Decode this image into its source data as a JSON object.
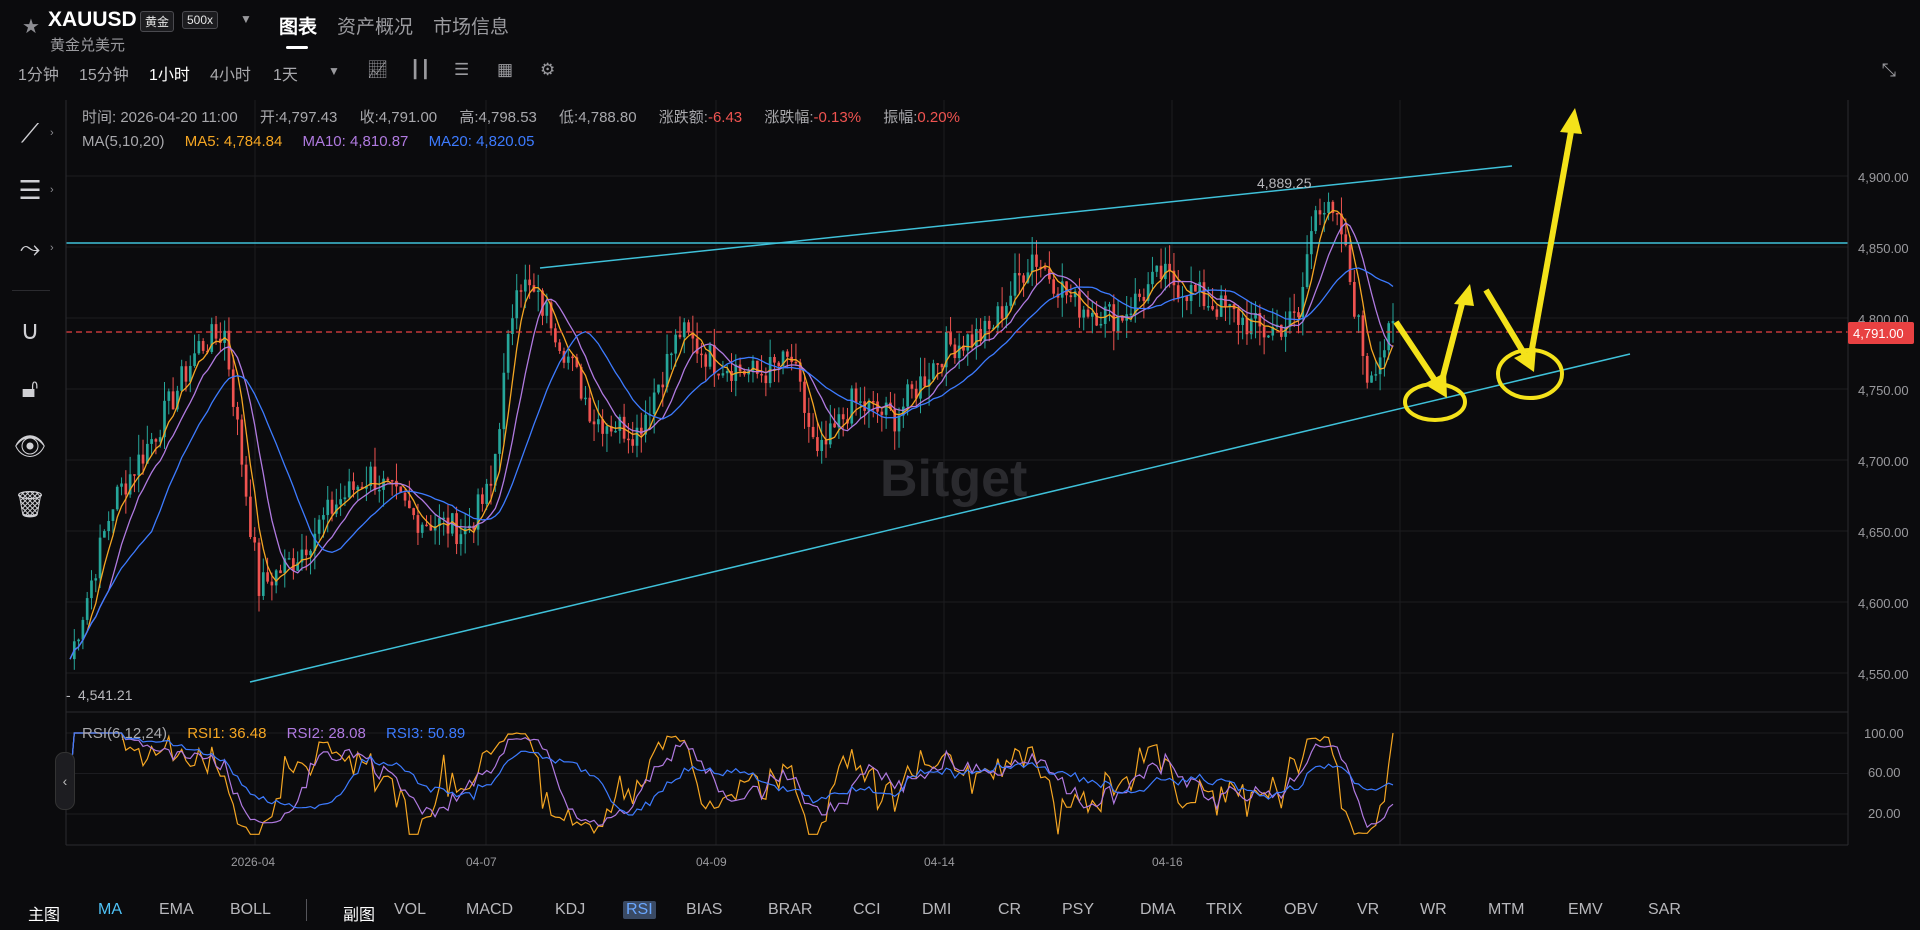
{
  "header": {
    "symbol": "XAUUSD",
    "category_tag": "黄金",
    "leverage_tag": "500x",
    "subtitle": "黄金兑美元",
    "tabs": [
      "图表",
      "资产概况",
      "市场信息"
    ],
    "active_tab": "图表"
  },
  "timeframes": [
    "1分钟",
    "15分钟",
    "1小时",
    "4小时",
    "1天"
  ],
  "active_timeframe": "1小时",
  "ohlc": {
    "time_label": "时间:",
    "time": "2026-04-20 11:00",
    "open_label": "开:",
    "open": "4,797.43",
    "close_label": "收:",
    "close": "4,791.00",
    "high_label": "高:",
    "high": "4,798.53",
    "low_label": "低:",
    "low": "4,788.80",
    "change_label": "涨跌额:",
    "change": "-6.43",
    "change_pct_label": "涨跌幅:",
    "change_pct": "-0.13%",
    "amplitude_label": "振幅:",
    "amplitude": "0.20%"
  },
  "ma": {
    "label": "MA(5,10,20)",
    "ma5_label": "MA5:",
    "ma5": "4,784.84",
    "ma10_label": "MA10:",
    "ma10": "4,810.87",
    "ma20_label": "MA20:",
    "ma20": "4,820.05"
  },
  "rsi": {
    "label": "RSI(6,12,24)",
    "rsi1_label": "RSI1:",
    "rsi1": "36.48",
    "rsi2_label": "RSI2:",
    "rsi2": "28.08",
    "rsi3_label": "RSI3:",
    "rsi3": "50.89"
  },
  "price_axis": [
    "4,900.00",
    "4,850.00",
    "4,800.00",
    "4,750.00",
    "4,700.00",
    "4,650.00",
    "4,600.00",
    "4,550.00"
  ],
  "rsi_axis": [
    "100.00",
    "60.00",
    "20.00"
  ],
  "date_axis": [
    "2026-04",
    "04-07",
    "04-09",
    "04-14",
    "04-16"
  ],
  "last_price": "4,791.00",
  "high_marker": "4,889.25",
  "low_marker": "4,541.21",
  "watermark": "Bitget",
  "bottom": {
    "main_label": "主图",
    "main_indicators": [
      "MA",
      "EMA",
      "BOLL"
    ],
    "active_main": "MA",
    "sub_label": "副图",
    "sub_indicators": [
      "VOL",
      "MACD",
      "KDJ",
      "RSI",
      "BIAS",
      "BRAR",
      "CCI",
      "DMI",
      "CR",
      "PSY",
      "DMA",
      "TRIX",
      "OBV",
      "VR",
      "WR",
      "MTM",
      "EMV",
      "SAR"
    ],
    "active_sub": "RSI"
  },
  "colors": {
    "up": "#26a69a",
    "down": "#ef5350",
    "ma5": "#f5a623",
    "ma10": "#b07ae0",
    "ma20": "#3d7bff",
    "trendline": "#3fc1d9",
    "annotation": "#f4e21a",
    "last_price_tag": "#e84142"
  },
  "chart_data": {
    "type": "candlestick",
    "price_range": [
      4520,
      4940
    ],
    "key_points": [
      {
        "t": 0,
        "p": 4560
      },
      {
        "t": 10,
        "p": 4670
      },
      {
        "t": 20,
        "p": 4720
      },
      {
        "t": 30,
        "p": 4780
      },
      {
        "t": 36,
        "p": 4790
      },
      {
        "t": 44,
        "p": 4610
      },
      {
        "t": 52,
        "p": 4630
      },
      {
        "t": 62,
        "p": 4670
      },
      {
        "t": 70,
        "p": 4690
      },
      {
        "t": 80,
        "p": 4660
      },
      {
        "t": 92,
        "p": 4650
      },
      {
        "t": 98,
        "p": 4680
      },
      {
        "t": 104,
        "p": 4830
      },
      {
        "t": 112,
        "p": 4800
      },
      {
        "t": 122,
        "p": 4730
      },
      {
        "t": 132,
        "p": 4720
      },
      {
        "t": 142,
        "p": 4790
      },
      {
        "t": 150,
        "p": 4770
      },
      {
        "t": 160,
        "p": 4760
      },
      {
        "t": 168,
        "p": 4770
      },
      {
        "t": 174,
        "p": 4700
      },
      {
        "t": 182,
        "p": 4740
      },
      {
        "t": 192,
        "p": 4730
      },
      {
        "t": 204,
        "p": 4780
      },
      {
        "t": 214,
        "p": 4790
      },
      {
        "t": 224,
        "p": 4845
      },
      {
        "t": 234,
        "p": 4810
      },
      {
        "t": 244,
        "p": 4800
      },
      {
        "t": 254,
        "p": 4830
      },
      {
        "t": 266,
        "p": 4810
      },
      {
        "t": 278,
        "p": 4790
      },
      {
        "t": 286,
        "p": 4800
      },
      {
        "t": 290,
        "p": 4885
      },
      {
        "t": 296,
        "p": 4860
      },
      {
        "t": 302,
        "p": 4760
      },
      {
        "t": 308,
        "p": 4791
      }
    ]
  }
}
